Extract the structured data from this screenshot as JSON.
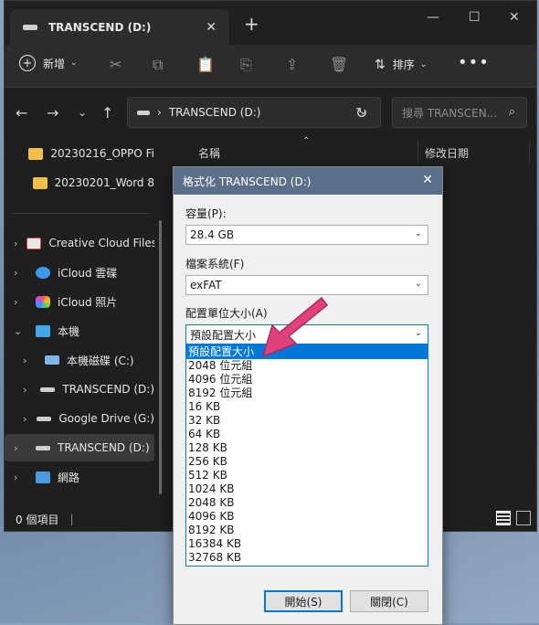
{
  "window": {
    "tab_title": "TRANSCEND (D:)",
    "new_tab_label": "+",
    "min_label": "—",
    "max_label": "☐",
    "close_label": "✕",
    "tab_close_label": "✕"
  },
  "toolbar": {
    "new_label": "新增",
    "sort_label": "排序",
    "more_label": "•••"
  },
  "address": {
    "path": "TRANSCEND (D:)",
    "search_placeholder": "搜尋 TRANSCEN..."
  },
  "sidebar": {
    "items": [
      {
        "label": "20230216_OPPO Fi",
        "icon": "folder-icon"
      },
      {
        "label": "20230201_Word 8",
        "icon": "folder-icon"
      },
      {
        "label": "Creative Cloud Files",
        "icon": "creative-cloud-icon"
      },
      {
        "label": "iCloud 雲碟",
        "icon": "icloud-icon"
      },
      {
        "label": "iCloud 照片",
        "icon": "photos-icon"
      },
      {
        "label": "本機",
        "icon": "computer-icon"
      },
      {
        "label": "本機磁碟 (C:)",
        "icon": "drive-icon"
      },
      {
        "label": "TRANSCEND (D:)",
        "icon": "drive-icon"
      },
      {
        "label": "Google Drive (G:)",
        "icon": "drive-icon"
      },
      {
        "label": "TRANSCEND (D:)",
        "icon": "drive-icon"
      },
      {
        "label": "網路",
        "icon": "network-icon"
      }
    ]
  },
  "content": {
    "col_name": "名稱",
    "col_modified": "修改日期"
  },
  "status": {
    "count": "0 個項目"
  },
  "dialog": {
    "title": "格式化 TRANSCEND (D:)",
    "capacity_label": "容量(P):",
    "capacity_value": "28.4 GB",
    "fs_label": "檔案系統(F)",
    "fs_value": "exFAT",
    "alloc_label": "配置單位大小(A)",
    "alloc_value": "預設配置大小",
    "options": [
      "預設配置大小",
      "2048 位元組",
      "4096 位元組",
      "8192 位元組",
      "16 KB",
      "32 KB",
      "64 KB",
      "128 KB",
      "256 KB",
      "512 KB",
      "1024 KB",
      "2048 KB",
      "4096 KB",
      "8192 KB",
      "16384 KB",
      "32768 KB"
    ],
    "start_label": "開始(S)",
    "close_label": "關閉(C)"
  },
  "colors": {
    "accent": "#0078d7",
    "arrow": "#e0417c"
  }
}
